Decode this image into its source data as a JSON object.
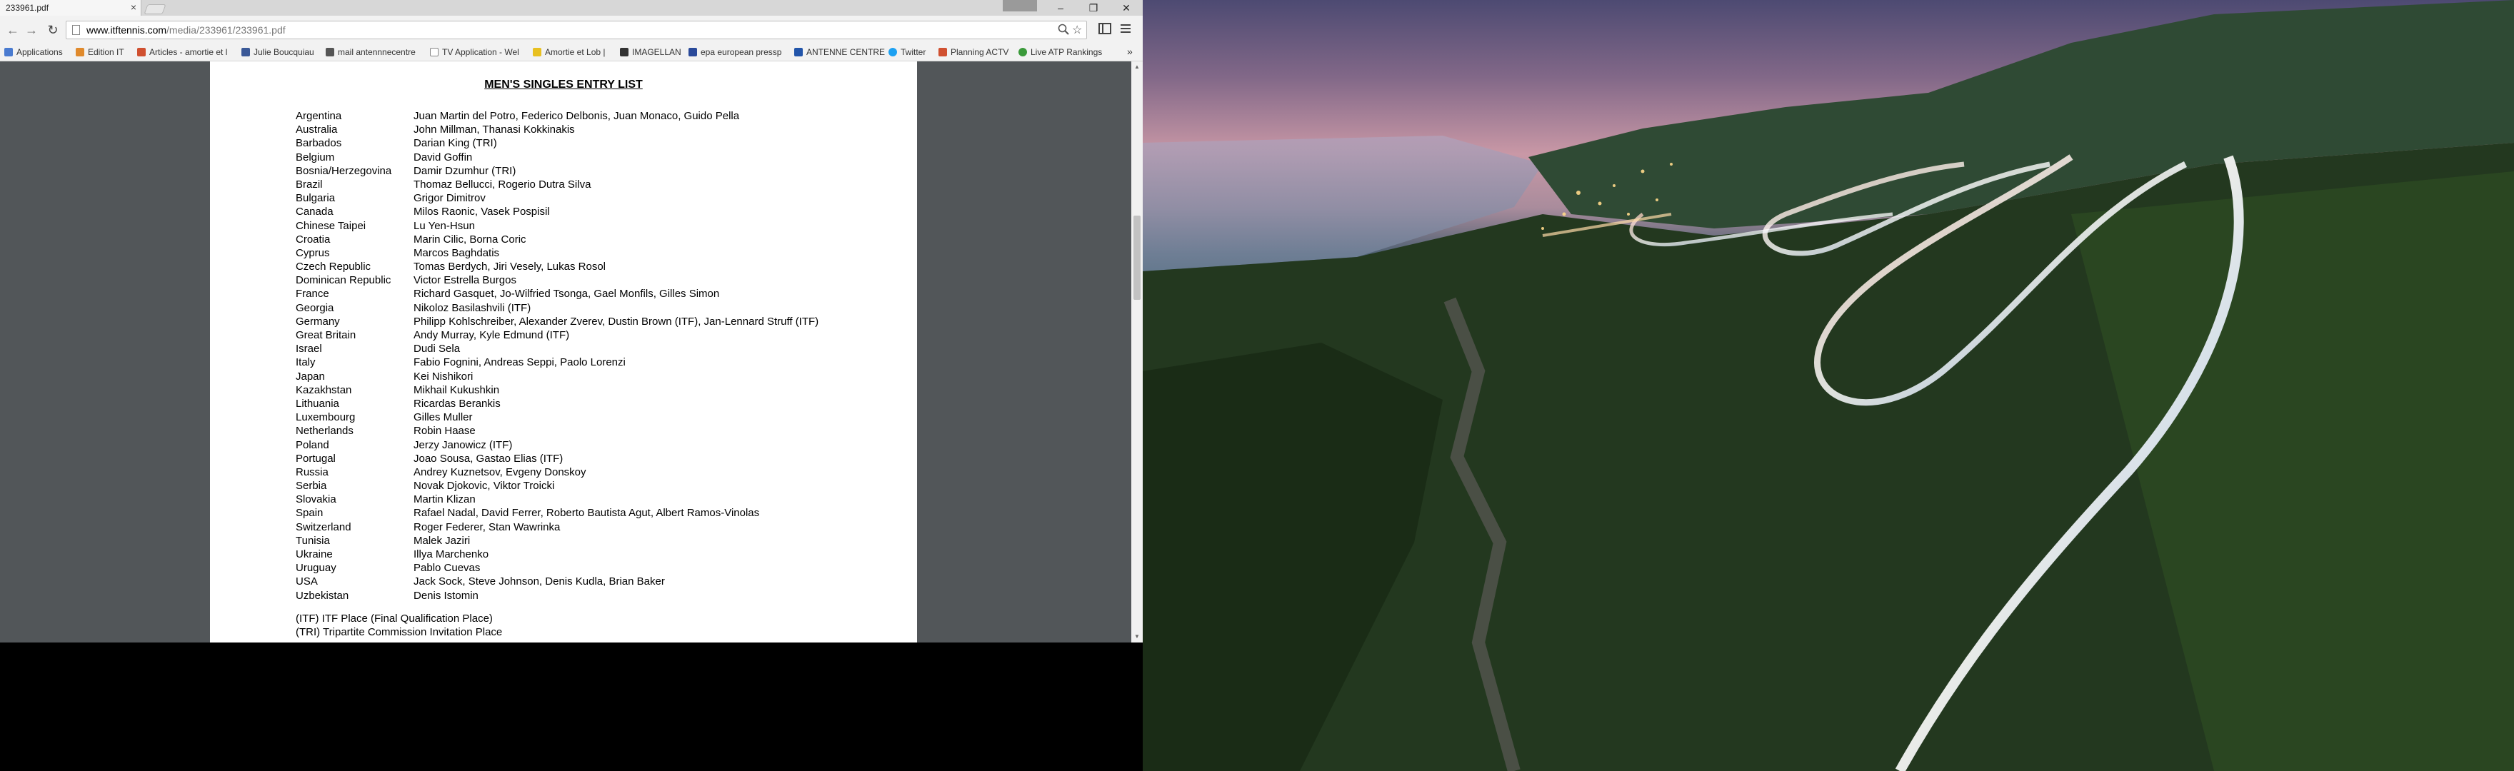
{
  "browser": {
    "tab_title": "233961.pdf",
    "tab_close": "×",
    "profile_badge": "",
    "window_buttons": [
      "–",
      "❐",
      "✕"
    ],
    "nav": {
      "back": "←",
      "forward": "→",
      "reload": "↻"
    },
    "url_host": "www.itftennis.com",
    "url_path": "/media/233961/233961.pdf",
    "bookmarks": [
      {
        "label": "Applications",
        "color": "#4a7bd0"
      },
      {
        "label": "Edition IT",
        "color": "#e08a2c"
      },
      {
        "label": "Articles - amortie et l",
        "color": "#d05030"
      },
      {
        "label": "Julie Boucquiau",
        "color": "#3b5998"
      },
      {
        "label": "mail antennnecentre",
        "color": "#555555"
      },
      {
        "label": "TV Application - Wel",
        "color": "#888888"
      },
      {
        "label": "Amortie et Lob |",
        "color": "#e8c020"
      },
      {
        "label": "IMAGELLAN",
        "color": "#333333"
      },
      {
        "label": "epa european pressp",
        "color": "#2a4a9a"
      },
      {
        "label": "ANTENNE CENTRE",
        "color": "#2255aa"
      },
      {
        "label": "Twitter",
        "color": "#1da1f2"
      },
      {
        "label": "Planning ACTV",
        "color": "#d05030"
      },
      {
        "label": "Live ATP Rankings",
        "color": "#3a9a3a"
      }
    ],
    "bookmarks_overflow": "»"
  },
  "pdf": {
    "title": "MEN'S SINGLES ENTRY LIST",
    "entries": [
      {
        "country": "Argentina",
        "players": "Juan Martin del Potro, Federico Delbonis, Juan Monaco, Guido Pella"
      },
      {
        "country": "Australia",
        "players": "John Millman, Thanasi Kokkinakis"
      },
      {
        "country": "Barbados",
        "players": "Darian King (TRI)"
      },
      {
        "country": "Belgium",
        "players": "David Goffin"
      },
      {
        "country": "Bosnia/Herzegovina",
        "players": "Damir Dzumhur (TRI)"
      },
      {
        "country": "Brazil",
        "players": "Thomaz Bellucci, Rogerio Dutra Silva"
      },
      {
        "country": "Bulgaria",
        "players": "Grigor Dimitrov"
      },
      {
        "country": "Canada",
        "players": "Milos Raonic, Vasek Pospisil"
      },
      {
        "country": "Chinese Taipei",
        "players": "Lu Yen-Hsun"
      },
      {
        "country": "Croatia",
        "players": "Marin Cilic, Borna Coric"
      },
      {
        "country": "Cyprus",
        "players": "Marcos Baghdatis"
      },
      {
        "country": "Czech Republic",
        "players": "Tomas Berdych, Jiri Vesely, Lukas Rosol"
      },
      {
        "country": "Dominican Republic",
        "players": "Victor Estrella Burgos"
      },
      {
        "country": "France",
        "players": "Richard Gasquet, Jo-Wilfried Tsonga, Gael Monfils, Gilles Simon"
      },
      {
        "country": "Georgia",
        "players": "Nikoloz Basilashvili (ITF)"
      },
      {
        "country": "Germany",
        "players": "Philipp Kohlschreiber, Alexander Zverev, Dustin Brown (ITF), Jan-Lennard Struff (ITF)"
      },
      {
        "country": "Great Britain",
        "players": "Andy Murray, Kyle Edmund (ITF)"
      },
      {
        "country": "Israel",
        "players": "Dudi Sela"
      },
      {
        "country": "Italy",
        "players": "Fabio Fognini, Andreas Seppi, Paolo Lorenzi"
      },
      {
        "country": "Japan",
        "players": "Kei Nishikori"
      },
      {
        "country": "Kazakhstan",
        "players": "Mikhail Kukushkin"
      },
      {
        "country": "Lithuania",
        "players": "Ricardas Berankis"
      },
      {
        "country": "Luxembourg",
        "players": "Gilles Muller"
      },
      {
        "country": "Netherlands",
        "players": "Robin Haase"
      },
      {
        "country": "Poland",
        "players": "Jerzy Janowicz (ITF)"
      },
      {
        "country": "Portugal",
        "players": "Joao Sousa, Gastao Elias (ITF)"
      },
      {
        "country": "Russia",
        "players": "Andrey Kuznetsov, Evgeny Donskoy"
      },
      {
        "country": "Serbia",
        "players": "Novak Djokovic, Viktor Troicki"
      },
      {
        "country": "Slovakia",
        "players": "Martin Klizan"
      },
      {
        "country": "Spain",
        "players": "Rafael Nadal, David Ferrer, Roberto Bautista Agut, Albert Ramos-Vinolas"
      },
      {
        "country": "Switzerland",
        "players": "Roger Federer, Stan Wawrinka"
      },
      {
        "country": "Tunisia",
        "players": "Malek Jaziri"
      },
      {
        "country": "Ukraine",
        "players": "Illya Marchenko"
      },
      {
        "country": "Uruguay",
        "players": "Pablo Cuevas"
      },
      {
        "country": "USA",
        "players": "Jack Sock, Steve Johnson, Denis Kudla, Brian Baker"
      },
      {
        "country": "Uzbekistan",
        "players": "Denis Istomin"
      }
    ],
    "footnotes": [
      "(ITF) ITF Place (Final Qualification Place)",
      "(TRI) Tripartite Commission Invitation Place"
    ]
  },
  "icons": {
    "zoom": "search-icon",
    "star": "star-icon",
    "extension": "extension-icon",
    "menu": "menu-icon"
  }
}
